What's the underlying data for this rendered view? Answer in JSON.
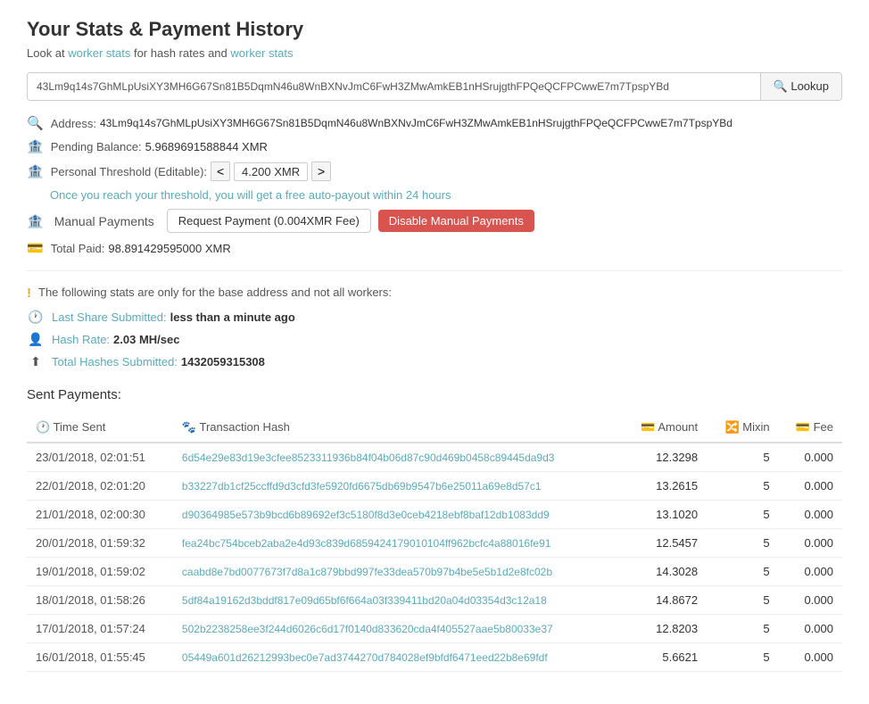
{
  "page": {
    "title": "Your Stats & Payment History",
    "subtitle_text": "Look at",
    "subtitle_links": [
      "worker stats",
      "for hash rates and",
      "worker stats"
    ],
    "lookup_placeholder": "43Lm9q14s7GhMLpUsiXY3MH6G67Sn81B5DqmN46u8WnBXNvJmC6FwH3ZMwAmkEB1nHSrujgthFPQeQCFPCwwE7m7TpspYBd",
    "lookup_button": "🔍 Lookup"
  },
  "wallet": {
    "address_label": "Address:",
    "address_value": "43Lm9q14s7GhMLpUsiXY3MH6G67Sn81B5DqmN46u8WnBXNvJmC6FwH3ZMwAmkEB1nHSrujgthFPQeQCFPCwwE7m7TpspYBd",
    "pending_balance_label": "Pending Balance:",
    "pending_balance_value": "5.9689691588844 XMR",
    "threshold_label": "Personal Threshold (Editable):",
    "threshold_value": "4.200 XMR",
    "threshold_less": "<",
    "threshold_more": ">",
    "auto_payout_note_prefix": "Once you reach your threshold, you",
    "auto_payout_note_link": "will get a free auto-payout within 24 hours",
    "manual_payments_label": "Manual Payments",
    "request_payment_button": "Request Payment (0.004XMR Fee)",
    "disable_manual_button": "Disable Manual Payments",
    "total_paid_label": "Total Paid:",
    "total_paid_value": "98.891429595000 XMR"
  },
  "stats": {
    "note": "The following stats are only for the base address and not all workers:",
    "last_share_label": "Last Share Submitted:",
    "last_share_value": "less than a minute ago",
    "hash_rate_label": "Hash Rate:",
    "hash_rate_value": "2.03 MH/sec",
    "total_hashes_label": "Total Hashes Submitted:",
    "total_hashes_value": "1432059315308"
  },
  "payments_table": {
    "title": "Sent Payments:",
    "columns": [
      "Time Sent",
      "Transaction Hash",
      "Amount",
      "Mixin",
      "Fee"
    ],
    "rows": [
      {
        "time": "23/01/2018, 02:01:51",
        "tx_hash": "6d54e29e83d19e3cfee8523311936b84f04b06d87c90d469b0458c89445da9d3",
        "amount": "12.3298",
        "mixin": "5",
        "fee": "0.000"
      },
      {
        "time": "22/01/2018, 02:01:20",
        "tx_hash": "b33227db1cf25ccffd9d3cfd3fe5920fd6675db69b9547b6e25011a69e8d57c1",
        "amount": "13.2615",
        "mixin": "5",
        "fee": "0.000"
      },
      {
        "time": "21/01/2018, 02:00:30",
        "tx_hash": "d90364985e573b9bcd6b89692ef3c5180f8d3e0ceb4218ebf8baf12db1083dd9",
        "amount": "13.1020",
        "mixin": "5",
        "fee": "0.000"
      },
      {
        "time": "20/01/2018, 01:59:32",
        "tx_hash": "fea24bc754bceb2aba2e4d93c839d6859424179010104ff962bcfc4a88016fe91",
        "amount": "12.5457",
        "mixin": "5",
        "fee": "0.000"
      },
      {
        "time": "19/01/2018, 01:59:02",
        "tx_hash": "caabd8e7bd0077673f7d8a1c879bbd997fe33dea570b97b4be5e5b1d2e8fc02b",
        "amount": "14.3028",
        "mixin": "5",
        "fee": "0.000"
      },
      {
        "time": "18/01/2018, 01:58:26",
        "tx_hash": "5df84a19162d3bddf817e09d65bf6f664a03f339411bd20a04d03354d3c12a18",
        "amount": "14.8672",
        "mixin": "5",
        "fee": "0.000"
      },
      {
        "time": "17/01/2018, 01:57:24",
        "tx_hash": "502b2238258ee3f244d6026c6d17f0140d833620cda4f405527aae5b80033e37",
        "amount": "12.8203",
        "mixin": "5",
        "fee": "0.000"
      },
      {
        "time": "16/01/2018, 01:55:45",
        "tx_hash": "05449a601d26212993bec0e7ad3744270d784028ef9bfdf6471eed22b8e69fdf",
        "amount": "5.6621",
        "mixin": "5",
        "fee": "0.000"
      }
    ]
  }
}
